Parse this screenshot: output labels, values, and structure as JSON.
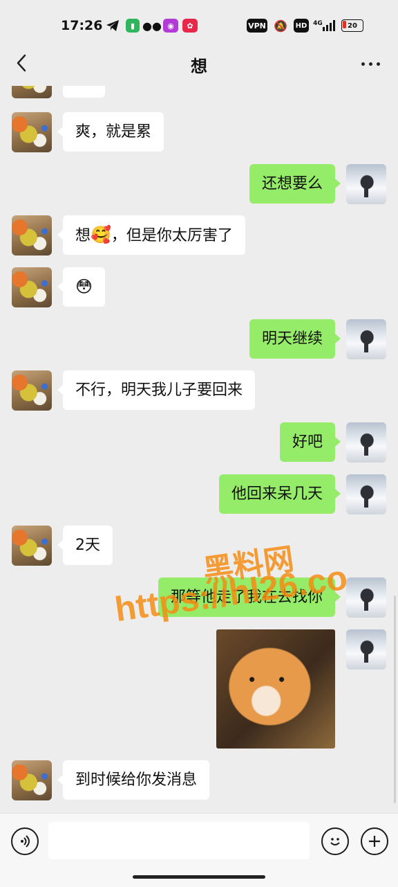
{
  "status_bar": {
    "time": "17:26",
    "vpn_label": "VPN",
    "hd_label": "HD",
    "network_label": "4G",
    "battery_level": "20",
    "icons": [
      "telegram-icon",
      "battery-app-icon",
      "wechat-icon",
      "app-icon",
      "app-icon-red",
      "mute-icon",
      "signal-icon"
    ]
  },
  "header": {
    "title": "想",
    "back_icon": "chevron-left-icon",
    "more_icon": "more-icon"
  },
  "messages": [
    {
      "side": "left",
      "text": "爽，就是累"
    },
    {
      "side": "right",
      "text": "还想要么"
    },
    {
      "side": "left",
      "text": "想",
      "emoji": "🥰",
      "text_after": "，但是你太厉害了"
    },
    {
      "side": "left",
      "emoji": "😳"
    },
    {
      "side": "right",
      "text": "明天继续"
    },
    {
      "side": "left",
      "text": "不行，明天我儿子要回来"
    },
    {
      "side": "right",
      "text": "好吧"
    },
    {
      "side": "right",
      "text": "他回来呆几天"
    },
    {
      "side": "left",
      "text": "2天"
    },
    {
      "side": "right",
      "text": "那等他走了我在去找你"
    },
    {
      "side": "right",
      "image": "cat-photo"
    },
    {
      "side": "left",
      "text": "到时候给你发消息"
    }
  ],
  "watermark": {
    "line1": "黑料网",
    "line2": "https://hl26.co"
  },
  "input_bar": {
    "voice_icon": "voice-icon",
    "emoji_icon": "emoji-icon",
    "plus_icon": "plus-icon",
    "placeholder": ""
  }
}
